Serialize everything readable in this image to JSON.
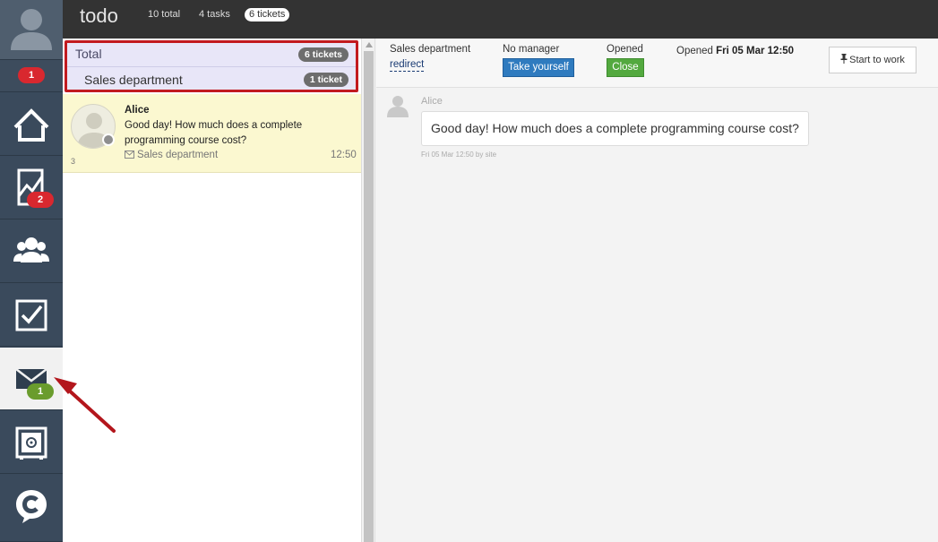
{
  "sidebar": {
    "user_badge": "1",
    "items": [
      {
        "name": "home",
        "icon": "home-icon",
        "badge": ""
      },
      {
        "name": "stats",
        "icon": "chart-icon",
        "badge": "2"
      },
      {
        "name": "clients",
        "icon": "users-icon",
        "badge": ""
      },
      {
        "name": "tasks",
        "icon": "checkbox-icon",
        "badge": ""
      },
      {
        "name": "tickets",
        "icon": "envelope-icon",
        "badge": "1"
      },
      {
        "name": "safe",
        "icon": "safe-icon",
        "badge": ""
      },
      {
        "name": "logo",
        "icon": "c-logo-icon",
        "badge": ""
      }
    ]
  },
  "topbar": {
    "title": "todo",
    "total": "10 total",
    "tasks": "4 tasks",
    "tickets": "6 tickets"
  },
  "groups": {
    "total_label": "Total",
    "total_count": "6 tickets",
    "sales_label": "Sales department",
    "sales_count": "1 ticket"
  },
  "ticket": {
    "name": "Alice",
    "message": "Good day! How much does a complete programming course cost?",
    "department": "Sales department",
    "time": "12:50",
    "number": "3"
  },
  "detail": {
    "department": "Sales department",
    "redirect": "redirect",
    "manager": "No manager",
    "take_button": "Take yourself",
    "status": "Opened",
    "close_button": "Close",
    "opened_prefix": "Opened",
    "opened_at": "Fri 05 Mar 12:50",
    "start_button": "Start to work"
  },
  "chat": {
    "author": "Alice",
    "message": "Good day! How much does a complete programming course cost?",
    "meta": "Fri 05 Mar 12:50 by site"
  },
  "colors": {
    "sidebar": "#3a4a5c",
    "highlight_border": "#c21a1f",
    "badge_red": "#d9282f",
    "badge_green": "#6a9c2d",
    "take_button": "#2f7bbf",
    "close_button": "#53a93f"
  }
}
